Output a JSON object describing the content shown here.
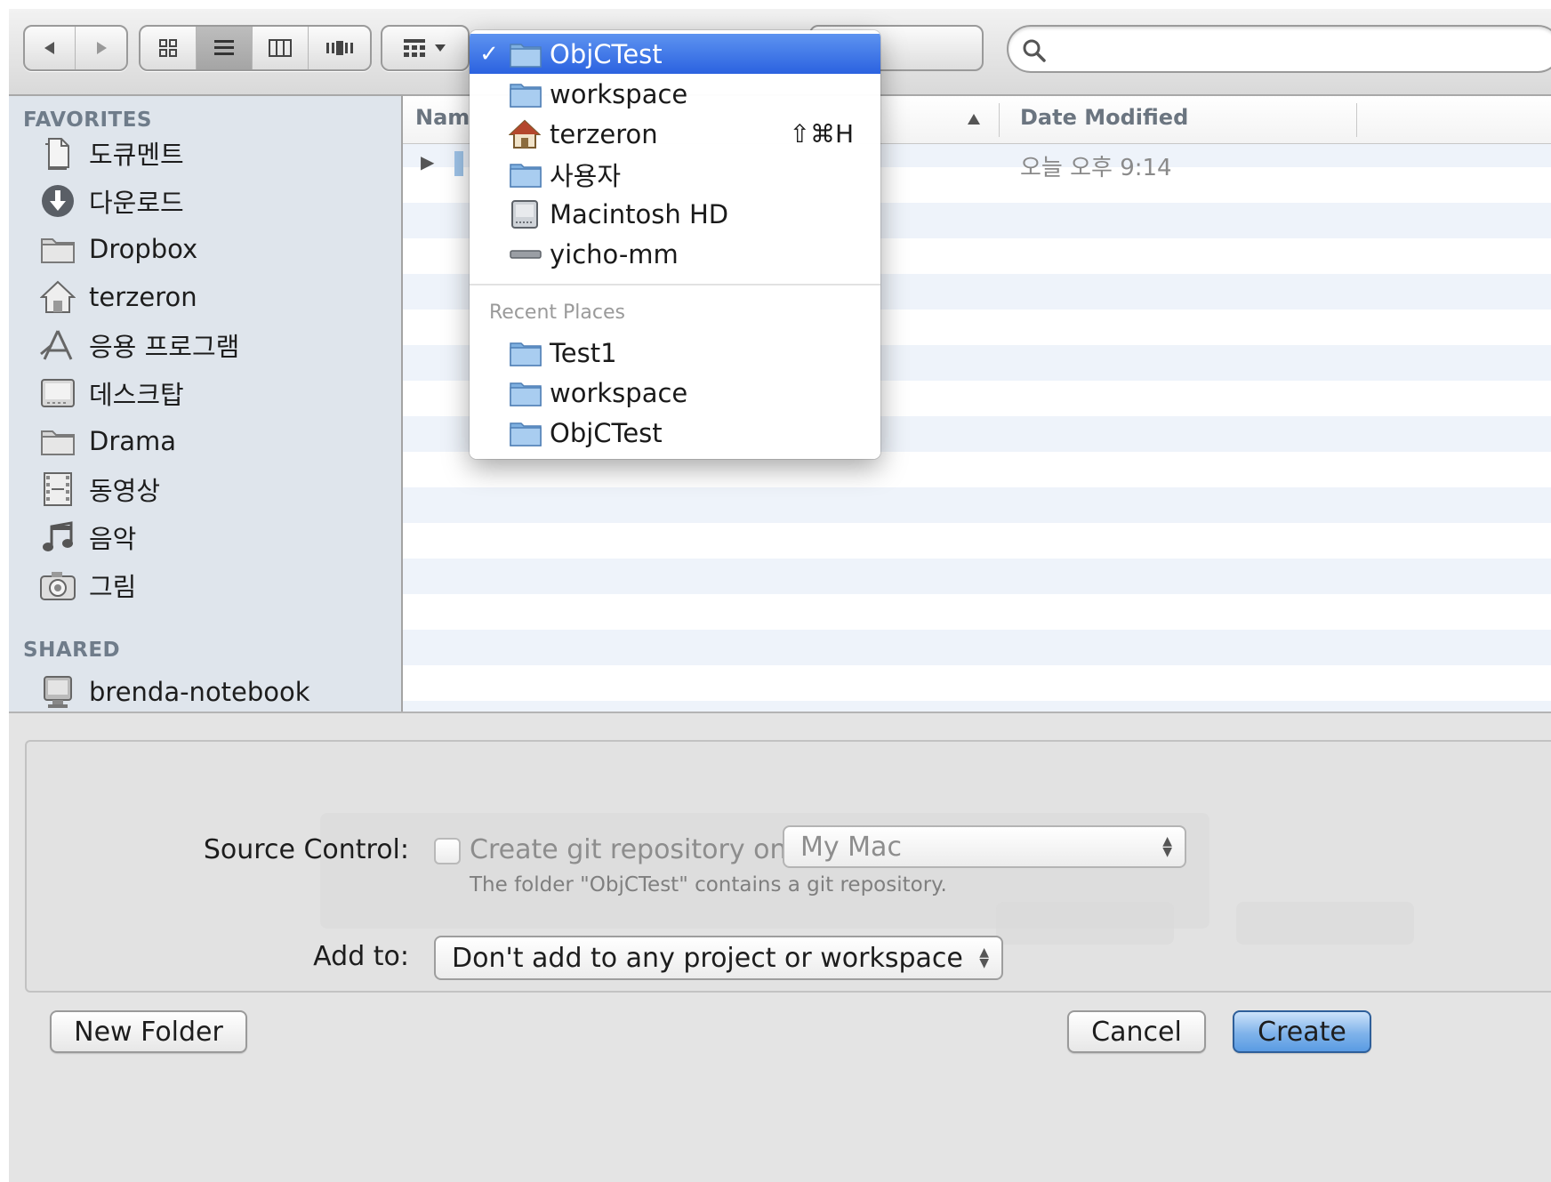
{
  "search": {
    "placeholder": ""
  },
  "sidebar": {
    "favorites_header": "FAVORITES",
    "favorites": [
      {
        "label": "도큐멘트",
        "icon": "documents-icon"
      },
      {
        "label": "다운로드",
        "icon": "downloads-icon"
      },
      {
        "label": "Dropbox",
        "icon": "folder-icon"
      },
      {
        "label": "terzeron",
        "icon": "home-icon"
      },
      {
        "label": "응용 프로그램",
        "icon": "applications-icon"
      },
      {
        "label": "데스크탑",
        "icon": "desktop-icon"
      },
      {
        "label": "Drama",
        "icon": "folder-icon"
      },
      {
        "label": "동영상",
        "icon": "movies-icon"
      },
      {
        "label": "음악",
        "icon": "music-icon"
      },
      {
        "label": "그림",
        "icon": "pictures-icon"
      }
    ],
    "shared_header": "SHARED",
    "shared": [
      {
        "label": "brenda-notebook",
        "icon": "computer-icon"
      }
    ]
  },
  "filelist": {
    "col_name": "Nam",
    "col_date": "Date Modified",
    "rows": [
      {
        "date": "오늘 오후 9:14"
      }
    ]
  },
  "path_menu": {
    "items": [
      {
        "label": "ObjCTest",
        "icon": "folder-icon",
        "checked": "✓",
        "shortcut": ""
      },
      {
        "label": "workspace",
        "icon": "folder-icon",
        "checked": "",
        "shortcut": ""
      },
      {
        "label": "terzeron",
        "icon": "home-icon",
        "checked": "",
        "shortcut": "⇧⌘H"
      },
      {
        "label": "사용자",
        "icon": "folder-icon",
        "checked": "",
        "shortcut": ""
      },
      {
        "label": "Macintosh HD",
        "icon": "hard-drive-icon",
        "checked": "",
        "shortcut": ""
      },
      {
        "label": "yicho-mm",
        "icon": "network-volume-icon",
        "checked": "",
        "shortcut": ""
      }
    ],
    "recent_header": "Recent Places",
    "recent": [
      {
        "label": "Test1",
        "icon": "folder-icon"
      },
      {
        "label": "workspace",
        "icon": "folder-icon"
      },
      {
        "label": "ObjCTest",
        "icon": "folder-icon"
      }
    ]
  },
  "accessory": {
    "source_control_label": "Source Control:",
    "git_checkbox_label": "Create git repository on",
    "git_checked": false,
    "machine_popup": "My Mac",
    "git_note": "The folder \"ObjCTest\" contains a git repository.",
    "add_to_label": "Add to:",
    "add_to_popup": "Don't add to any project or workspace"
  },
  "buttons": {
    "new_folder": "New Folder",
    "cancel": "Cancel",
    "create": "Create"
  },
  "colors": {
    "selection": "#2b62e0",
    "sidebar_bg": "#dfe5ec",
    "create_button": "#5a9be3"
  }
}
